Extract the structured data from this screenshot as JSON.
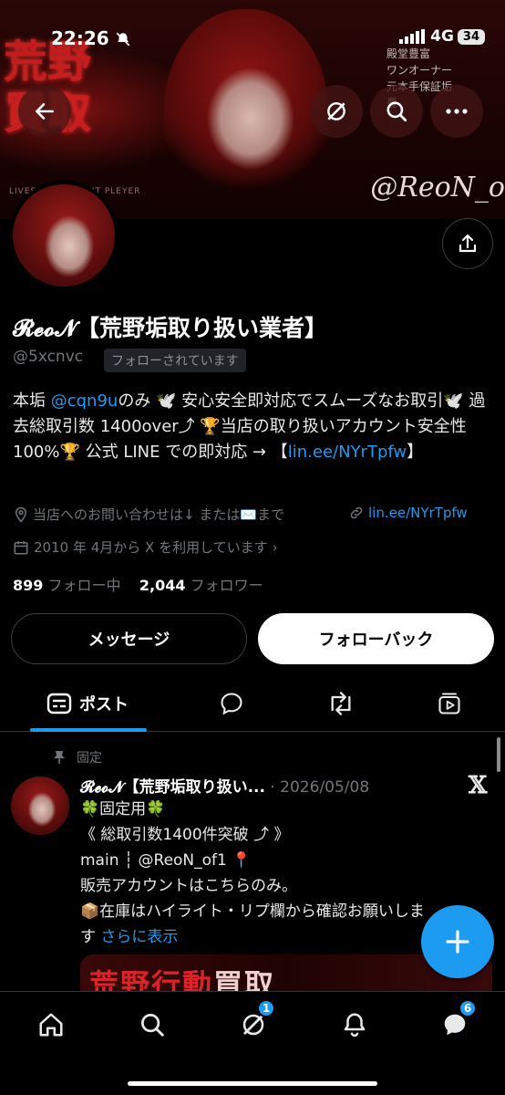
{
  "status_bar": {
    "time": "22:26",
    "network": "4G",
    "battery": "34"
  },
  "banner": {
    "kanji": "荒野\n買取",
    "small_text": "LIVES OIUT COUNT PLEYER",
    "list": [
      "殿堂豊富",
      "ワンオーナー",
      "元本手保証垢",
      "豊"
    ],
    "handle": "@ReoN_o"
  },
  "profile": {
    "name": "𝓡𝓮𝓸𝓝【荒野垢取り扱い業者】",
    "handle": "@5xcnvc",
    "follows_you": "フォローされています",
    "bio_parts": {
      "p1": "本垢 ",
      "mention": "@cqn9u",
      "p2": "のみ 🕊️ 安心安全即対応でスムーズなお取引🕊️ 過去総取引数 1400over⤴ 🏆当店の取り扱いアカウント安全性 100%🏆 公式 LINE での即対応 → 【",
      "link": "lin.ee/NYrTpfw",
      "p3": "】"
    },
    "location": "当店へのお問い合わせは↓ または✉️まで",
    "website": "lin.ee/NYrTpfw",
    "joined": "2010 年 4月から X を利用しています",
    "following_count": "899",
    "following_label": "フォロー中",
    "followers_count": "2,044",
    "followers_label": "フォロワー"
  },
  "buttons": {
    "message": "メッセージ",
    "follow_back": "フォローバック"
  },
  "tabs": {
    "posts": "ポスト"
  },
  "pinned_post": {
    "pinned_label": "固定",
    "author": "𝓡𝓮𝓸𝓝【荒野垢取り扱い...",
    "date": " · 2026/05/08",
    "lines": [
      "🍀固定用🍀",
      "《 総取引数1400件突破 ⤴ 》",
      "main ┆ @ReoN_of1 📍",
      "販売アカウントはこちらのみ。",
      "📦在庫はハイライト・リプ欄から確認お願いしま"
    ],
    "last_line_prefix": "す ",
    "show_more": "さらに表示",
    "image_text_red": "荒野行動",
    "image_text_white": "買取"
  },
  "bottom_nav": {
    "grok_badge": "1",
    "messages_badge": "6"
  },
  "colors": {
    "accent": "#1d9bf0",
    "background": "#000000",
    "secondary_text": "#71767b"
  }
}
